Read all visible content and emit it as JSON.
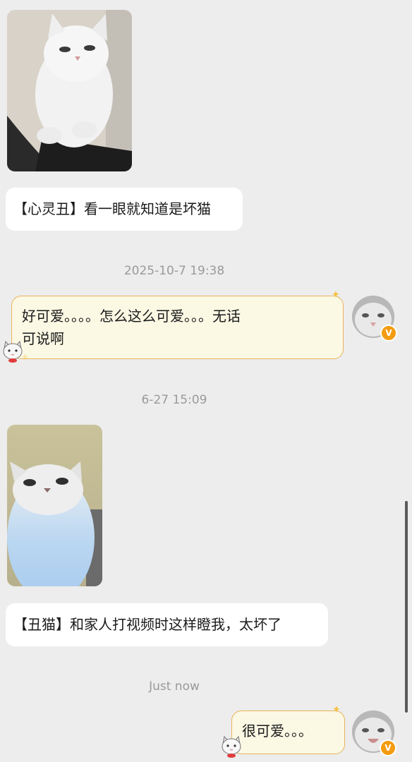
{
  "messages": {
    "m1_text": "【心灵丑】看一眼就知道是坏猫",
    "ts1": "2025-10-7 19:38",
    "m2_line1": "好可爱。。。。怎么这么可爱。。。无话",
    "m2_line2": "可说啊",
    "ts2": "6-27 15:09",
    "m3_text": "【丑猫】和家人打视频时这样瞪我，太坏了",
    "ts3": "Just now",
    "m4_text": "很可爱。。。"
  },
  "badges": {
    "verified_mark": "V"
  },
  "colors": {
    "background": "#ededed",
    "outgoing_bubble": "#fbf8e4",
    "outgoing_border": "#e8b45c",
    "timestamp": "#9a9a9a",
    "verified": "#f39c12"
  }
}
